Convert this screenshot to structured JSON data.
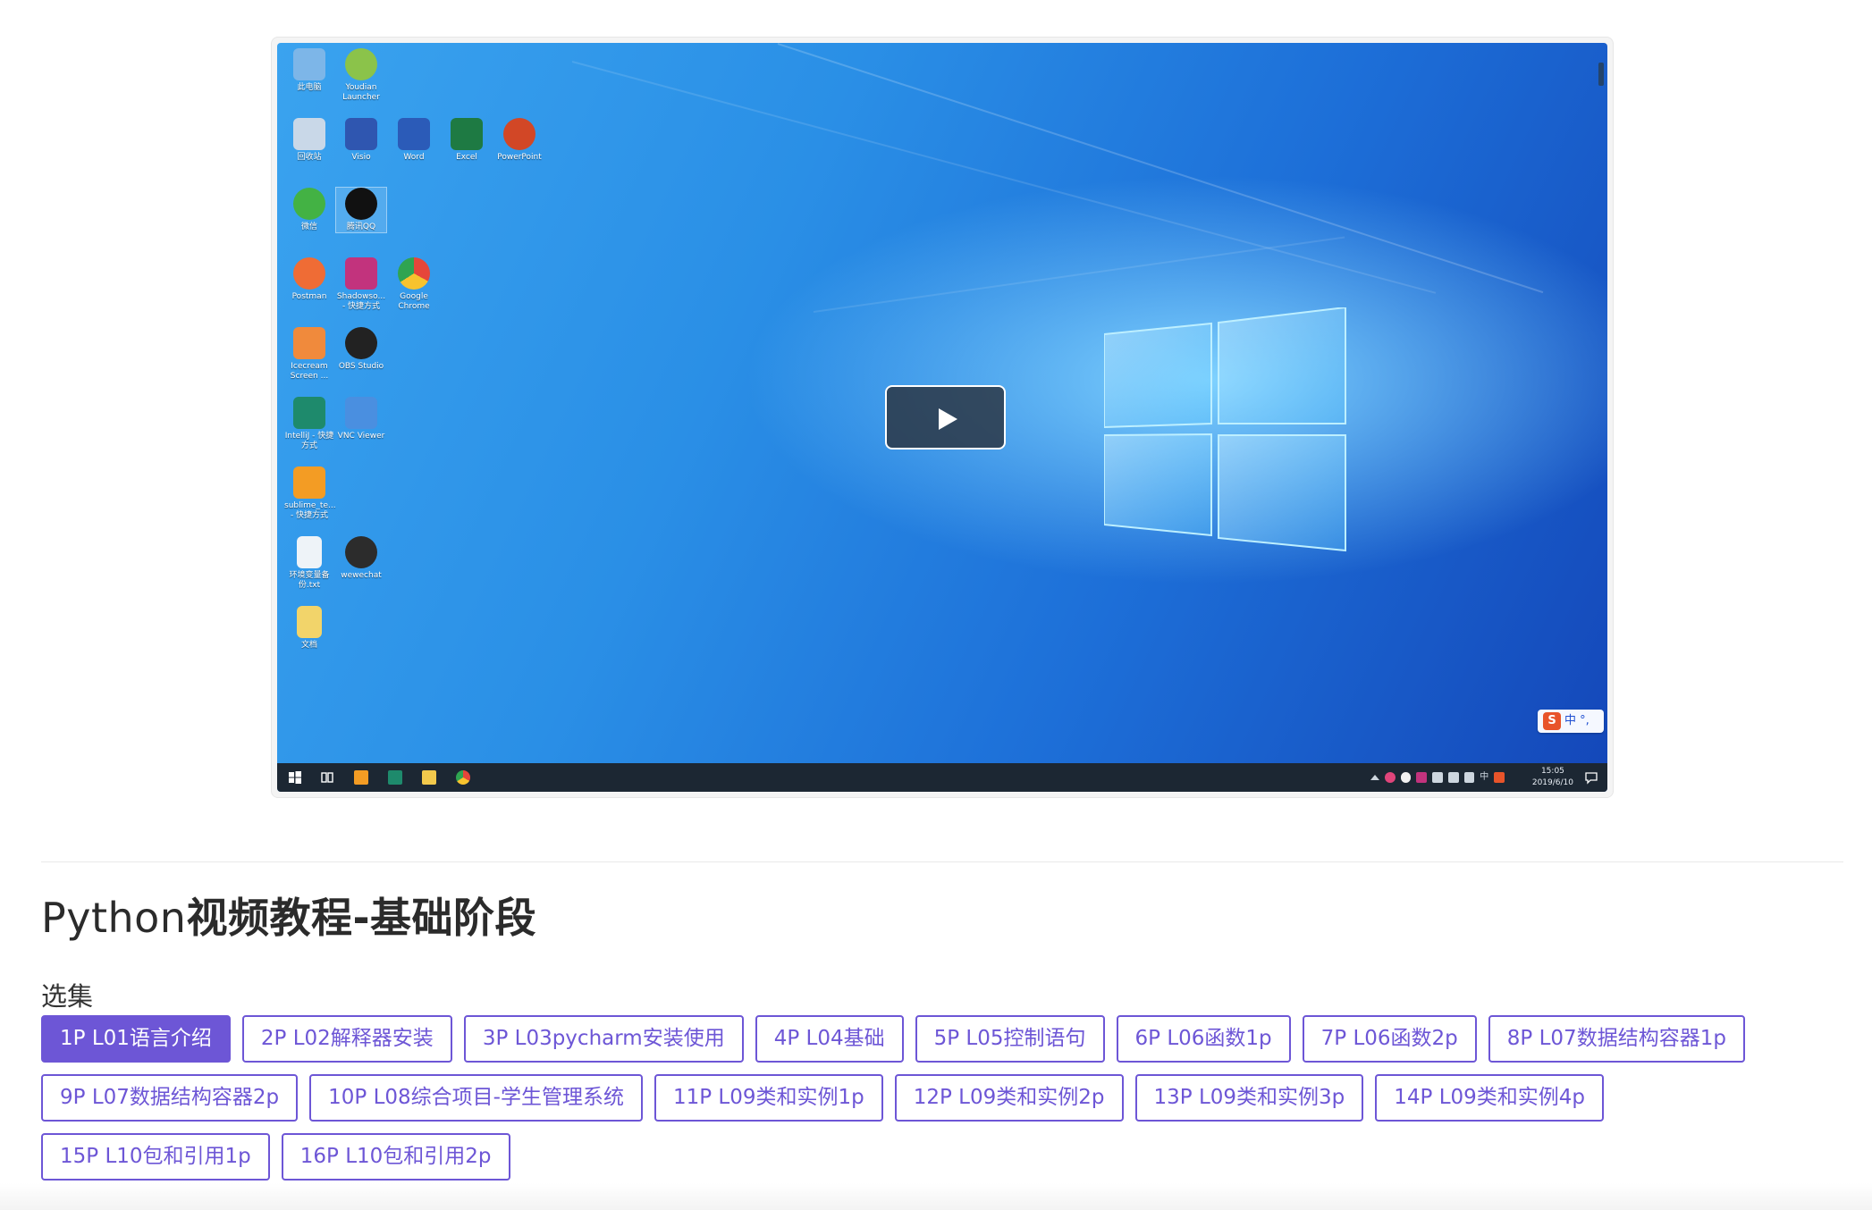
{
  "player": {
    "desktop_icons": [
      {
        "label": "此电脑",
        "icon": "computer-icon",
        "color": "#7db6e8"
      },
      {
        "label": "Youdian Launcher",
        "icon": "fingerprint-icon",
        "color": "#8bc34a"
      },
      {
        "label": "回收站",
        "icon": "recycle-bin-icon",
        "color": "#c9d8e8"
      },
      {
        "label": "Visio",
        "icon": "visio-icon",
        "color": "#2f56b0"
      },
      {
        "label": "Word",
        "icon": "word-icon",
        "color": "#2b5bb8"
      },
      {
        "label": "Excel",
        "icon": "excel-icon",
        "color": "#1e7a43"
      },
      {
        "label": "PowerPoint",
        "icon": "powerpoint-icon",
        "color": "#d24726"
      },
      {
        "label": "微信",
        "icon": "wechat-icon",
        "color": "#43b244"
      },
      {
        "label": "腾讯QQ",
        "icon": "qq-icon",
        "color": "#111111"
      },
      {
        "label": "Postman",
        "icon": "postman-icon",
        "color": "#ef6c35"
      },
      {
        "label": "Shadowso... - 快捷方式",
        "icon": "shadowsocks-icon",
        "color": "#c2337d"
      },
      {
        "label": "Google Chrome",
        "icon": "chrome-icon",
        "color": "#e6463a"
      },
      {
        "label": "Icecream Screen ...",
        "icon": "icecream-icon",
        "color": "#f08a3c"
      },
      {
        "label": "OBS Studio",
        "icon": "obs-icon",
        "color": "#222222"
      },
      {
        "label": "IntelliJ - 快捷方式",
        "icon": "intellij-icon",
        "color": "#1e8a6c"
      },
      {
        "label": "VNC Viewer",
        "icon": "vnc-icon",
        "color": "#4a8fe0"
      },
      {
        "label": "sublime_te... - 快捷方式",
        "icon": "sublime-icon",
        "color": "#f39c24"
      },
      {
        "label": "环境变量备份.txt",
        "icon": "text-file-icon",
        "color": "#eef3f8"
      },
      {
        "label": "wewechat",
        "icon": "wewechat-icon",
        "color": "#2c2c2c"
      },
      {
        "label": "文档",
        "icon": "folder-icon",
        "color": "#f2d46a"
      }
    ],
    "ime": {
      "logo": "S",
      "text": "中 °,"
    },
    "tray": {
      "lang": "中"
    },
    "clock": {
      "time": "15:05",
      "date": "2019/6/10"
    },
    "play_button_label": "play"
  },
  "course": {
    "title_prefix": "Python",
    "title_rest": "视频教程-基础阶段",
    "episodes_label": "选集",
    "active_index": 0,
    "episodes": [
      "1P L01语言介绍",
      "2P L02解释器安装",
      "3P L03pycharm安装使用",
      "4P L04基础",
      "5P L05控制语句",
      "6P L06函数1p",
      "7P L06函数2p",
      "8P L07数据结构容器1p",
      "9P L07数据结构容器2p",
      "10P L08综合项目-学生管理系统",
      "11P L09类和实例1p",
      "12P L09类和实例2p",
      "13P L09类和实例3p",
      "14P L09类和实例4p",
      "15P L10包和引用1p",
      "16P L10包和引用2p"
    ]
  },
  "colors": {
    "accent": "#6d56d6",
    "desktop_blue": "#2a8fe6",
    "taskbar": "#1c2733"
  }
}
